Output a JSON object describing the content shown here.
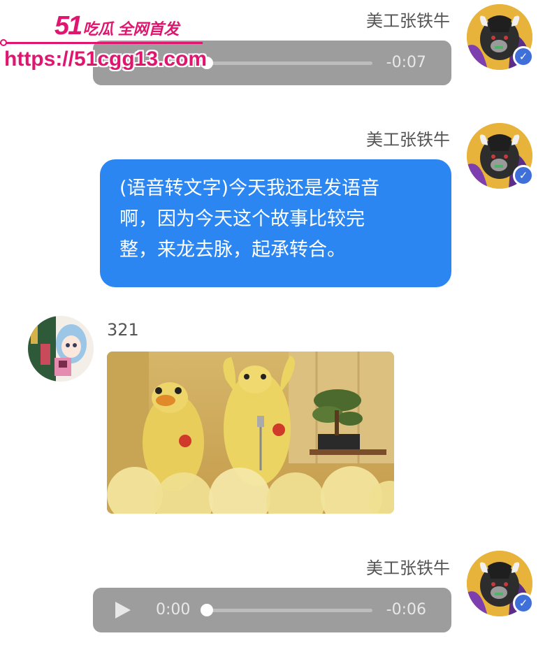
{
  "watermark": {
    "brand_number": "51",
    "brand_text": "吃瓜 全网首发",
    "url": "https://51cgg13.com"
  },
  "messages": [
    {
      "type": "audio",
      "sender": "美工张铁牛",
      "current_time": "0:00",
      "remaining_time": "-0:07",
      "progress": 0
    },
    {
      "type": "text",
      "sender": "美工张铁牛",
      "lines": [
        "(语音转文字)今天我还是发语音",
        "啊，因为今天这个故事比较完",
        "整，来龙去脉，起承转合。"
      ],
      "bubble_color": "#2b86f2"
    },
    {
      "type": "image",
      "sender": "321",
      "image_icon": "dancing-chickens-gif"
    },
    {
      "type": "audio",
      "sender": "美工张铁牛",
      "current_time": "0:00",
      "remaining_time": "-0:06",
      "progress": 0
    }
  ],
  "colors": {
    "audio_bg": "#9d9d9d",
    "verified_badge": "#3f6fd8",
    "watermark": "#e0156f"
  }
}
